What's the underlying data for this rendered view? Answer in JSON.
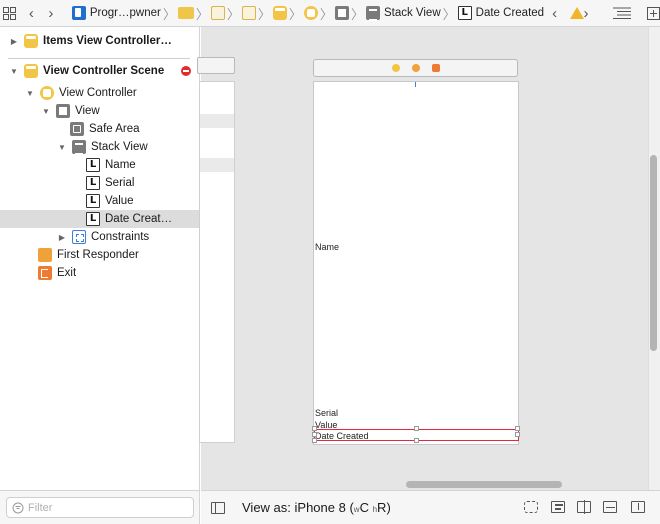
{
  "jump_bar": {
    "project_label": "Progr…pwner",
    "stack_view_label": "Stack View",
    "selected_label": "Date Created"
  },
  "outline": {
    "rows": [
      {
        "label": "Items View Controller…"
      },
      {
        "label": "View Controller Scene"
      },
      {
        "label": "View Controller"
      },
      {
        "label": "View"
      },
      {
        "label": "Safe Area"
      },
      {
        "label": "Stack View"
      },
      {
        "label": "Name"
      },
      {
        "label": "Serial"
      },
      {
        "label": "Value"
      },
      {
        "label": "Date Creat…"
      },
      {
        "label": "Constraints"
      },
      {
        "label": "First Responder"
      },
      {
        "label": "Exit"
      }
    ],
    "label_icon_glyph": "L"
  },
  "canvas": {
    "labels": {
      "name": "Name",
      "serial": "Serial",
      "value": "Value",
      "date_created": "Date Created"
    }
  },
  "filter": {
    "placeholder": "Filter"
  },
  "bottom_bar": {
    "view_as": "View as: iPhone 8",
    "size_open": " (",
    "w": "w",
    "compact": "C",
    "h": "h",
    "regular": "R",
    "size_close": ")"
  },
  "colors": {
    "selection_frame": "#e02a3a",
    "accent_yellow": "#f3c546",
    "warning": "#f0b62a",
    "error": "#e22b2b"
  }
}
